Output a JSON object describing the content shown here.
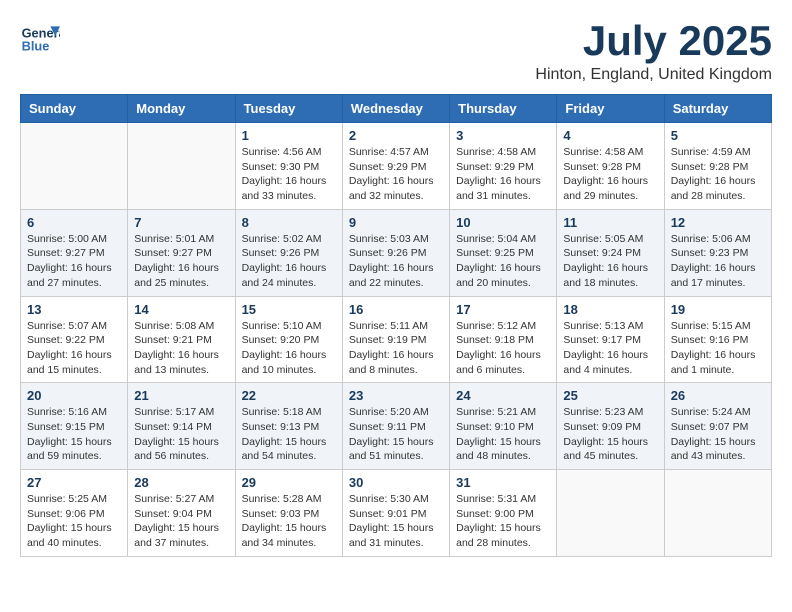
{
  "header": {
    "logo_line1": "General",
    "logo_line2": "Blue",
    "month": "July 2025",
    "location": "Hinton, England, United Kingdom"
  },
  "weekdays": [
    "Sunday",
    "Monday",
    "Tuesday",
    "Wednesday",
    "Thursday",
    "Friday",
    "Saturday"
  ],
  "weeks": [
    [
      {
        "day": "",
        "info": ""
      },
      {
        "day": "",
        "info": ""
      },
      {
        "day": "1",
        "info": "Sunrise: 4:56 AM\nSunset: 9:30 PM\nDaylight: 16 hours\nand 33 minutes."
      },
      {
        "day": "2",
        "info": "Sunrise: 4:57 AM\nSunset: 9:29 PM\nDaylight: 16 hours\nand 32 minutes."
      },
      {
        "day": "3",
        "info": "Sunrise: 4:58 AM\nSunset: 9:29 PM\nDaylight: 16 hours\nand 31 minutes."
      },
      {
        "day": "4",
        "info": "Sunrise: 4:58 AM\nSunset: 9:28 PM\nDaylight: 16 hours\nand 29 minutes."
      },
      {
        "day": "5",
        "info": "Sunrise: 4:59 AM\nSunset: 9:28 PM\nDaylight: 16 hours\nand 28 minutes."
      }
    ],
    [
      {
        "day": "6",
        "info": "Sunrise: 5:00 AM\nSunset: 9:27 PM\nDaylight: 16 hours\nand 27 minutes."
      },
      {
        "day": "7",
        "info": "Sunrise: 5:01 AM\nSunset: 9:27 PM\nDaylight: 16 hours\nand 25 minutes."
      },
      {
        "day": "8",
        "info": "Sunrise: 5:02 AM\nSunset: 9:26 PM\nDaylight: 16 hours\nand 24 minutes."
      },
      {
        "day": "9",
        "info": "Sunrise: 5:03 AM\nSunset: 9:26 PM\nDaylight: 16 hours\nand 22 minutes."
      },
      {
        "day": "10",
        "info": "Sunrise: 5:04 AM\nSunset: 9:25 PM\nDaylight: 16 hours\nand 20 minutes."
      },
      {
        "day": "11",
        "info": "Sunrise: 5:05 AM\nSunset: 9:24 PM\nDaylight: 16 hours\nand 18 minutes."
      },
      {
        "day": "12",
        "info": "Sunrise: 5:06 AM\nSunset: 9:23 PM\nDaylight: 16 hours\nand 17 minutes."
      }
    ],
    [
      {
        "day": "13",
        "info": "Sunrise: 5:07 AM\nSunset: 9:22 PM\nDaylight: 16 hours\nand 15 minutes."
      },
      {
        "day": "14",
        "info": "Sunrise: 5:08 AM\nSunset: 9:21 PM\nDaylight: 16 hours\nand 13 minutes."
      },
      {
        "day": "15",
        "info": "Sunrise: 5:10 AM\nSunset: 9:20 PM\nDaylight: 16 hours\nand 10 minutes."
      },
      {
        "day": "16",
        "info": "Sunrise: 5:11 AM\nSunset: 9:19 PM\nDaylight: 16 hours\nand 8 minutes."
      },
      {
        "day": "17",
        "info": "Sunrise: 5:12 AM\nSunset: 9:18 PM\nDaylight: 16 hours\nand 6 minutes."
      },
      {
        "day": "18",
        "info": "Sunrise: 5:13 AM\nSunset: 9:17 PM\nDaylight: 16 hours\nand 4 minutes."
      },
      {
        "day": "19",
        "info": "Sunrise: 5:15 AM\nSunset: 9:16 PM\nDaylight: 16 hours\nand 1 minute."
      }
    ],
    [
      {
        "day": "20",
        "info": "Sunrise: 5:16 AM\nSunset: 9:15 PM\nDaylight: 15 hours\nand 59 minutes."
      },
      {
        "day": "21",
        "info": "Sunrise: 5:17 AM\nSunset: 9:14 PM\nDaylight: 15 hours\nand 56 minutes."
      },
      {
        "day": "22",
        "info": "Sunrise: 5:18 AM\nSunset: 9:13 PM\nDaylight: 15 hours\nand 54 minutes."
      },
      {
        "day": "23",
        "info": "Sunrise: 5:20 AM\nSunset: 9:11 PM\nDaylight: 15 hours\nand 51 minutes."
      },
      {
        "day": "24",
        "info": "Sunrise: 5:21 AM\nSunset: 9:10 PM\nDaylight: 15 hours\nand 48 minutes."
      },
      {
        "day": "25",
        "info": "Sunrise: 5:23 AM\nSunset: 9:09 PM\nDaylight: 15 hours\nand 45 minutes."
      },
      {
        "day": "26",
        "info": "Sunrise: 5:24 AM\nSunset: 9:07 PM\nDaylight: 15 hours\nand 43 minutes."
      }
    ],
    [
      {
        "day": "27",
        "info": "Sunrise: 5:25 AM\nSunset: 9:06 PM\nDaylight: 15 hours\nand 40 minutes."
      },
      {
        "day": "28",
        "info": "Sunrise: 5:27 AM\nSunset: 9:04 PM\nDaylight: 15 hours\nand 37 minutes."
      },
      {
        "day": "29",
        "info": "Sunrise: 5:28 AM\nSunset: 9:03 PM\nDaylight: 15 hours\nand 34 minutes."
      },
      {
        "day": "30",
        "info": "Sunrise: 5:30 AM\nSunset: 9:01 PM\nDaylight: 15 hours\nand 31 minutes."
      },
      {
        "day": "31",
        "info": "Sunrise: 5:31 AM\nSunset: 9:00 PM\nDaylight: 15 hours\nand 28 minutes."
      },
      {
        "day": "",
        "info": ""
      },
      {
        "day": "",
        "info": ""
      }
    ]
  ]
}
